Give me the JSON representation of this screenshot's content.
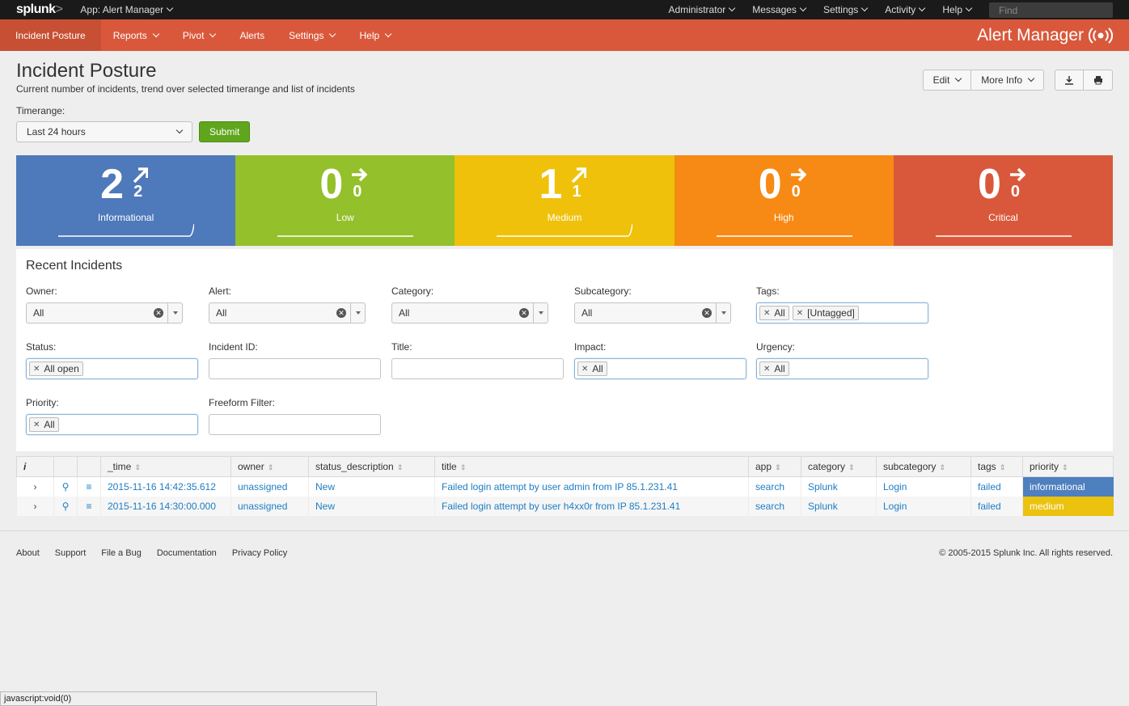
{
  "topbar": {
    "logo_text": "splunk",
    "logo_suffix": ">",
    "app_label": "App: Alert Manager",
    "menus": [
      "Administrator",
      "Messages",
      "Settings",
      "Activity",
      "Help"
    ],
    "find_placeholder": "Find"
  },
  "nav": {
    "items": [
      "Incident Posture",
      "Reports",
      "Pivot",
      "Alerts",
      "Settings",
      "Help"
    ],
    "brand": "Alert Manager"
  },
  "header": {
    "title": "Incident Posture",
    "description": "Current number of incidents, trend over selected timerange and list of incidents",
    "edit_label": "Edit",
    "more_info_label": "More Info"
  },
  "timerange": {
    "label": "Timerange:",
    "value": "Last 24 hours",
    "submit_label": "Submit"
  },
  "tiles": [
    {
      "value": "2",
      "delta": "2",
      "label": "Informational",
      "color": "#4e79ba",
      "trend": "up"
    },
    {
      "value": "0",
      "delta": "0",
      "label": "Low",
      "color": "#93c02b",
      "trend": "flat"
    },
    {
      "value": "1",
      "delta": "1",
      "label": "Medium",
      "color": "#efc10b",
      "trend": "up"
    },
    {
      "value": "0",
      "delta": "0",
      "label": "High",
      "color": "#f68a15",
      "trend": "flat"
    },
    {
      "value": "0",
      "delta": "0",
      "label": "Critical",
      "color": "#d9583b",
      "trend": "flat"
    }
  ],
  "filters": {
    "title": "Recent Incidents",
    "owner": {
      "label": "Owner:",
      "value": "All"
    },
    "alert": {
      "label": "Alert:",
      "value": "All"
    },
    "category": {
      "label": "Category:",
      "value": "All"
    },
    "subcategory": {
      "label": "Subcategory:",
      "value": "All"
    },
    "tags": {
      "label": "Tags:",
      "chips": [
        "All",
        "[Untagged]"
      ]
    },
    "status": {
      "label": "Status:",
      "chips": [
        "All open"
      ]
    },
    "incident_id": {
      "label": "Incident ID:"
    },
    "title_field": {
      "label": "Title:"
    },
    "impact": {
      "label": "Impact:",
      "chips": [
        "All"
      ]
    },
    "urgency": {
      "label": "Urgency:",
      "chips": [
        "All"
      ]
    },
    "priority": {
      "label": "Priority:",
      "chips": [
        "All"
      ]
    },
    "freeform": {
      "label": "Freeform Filter:"
    }
  },
  "table": {
    "columns": [
      "i",
      "_time",
      "owner",
      "status_description",
      "title",
      "app",
      "category",
      "subcategory",
      "tags",
      "priority"
    ],
    "rows": [
      {
        "time": "2015-11-16 14:42:35.612",
        "owner": "unassigned",
        "status": "New",
        "title": "Failed login attempt by user admin from IP 85.1.231.41",
        "app": "search",
        "category": "Splunk",
        "subcategory": "Login",
        "tags": "failed",
        "priority": "informational"
      },
      {
        "time": "2015-11-16 14:30:00.000",
        "owner": "unassigned",
        "status": "New",
        "title": "Failed login attempt by user h4xx0r from IP 85.1.231.41",
        "app": "search",
        "category": "Splunk",
        "subcategory": "Login",
        "tags": "failed",
        "priority": "medium"
      }
    ]
  },
  "footer": {
    "links": [
      "About",
      "Support",
      "File a Bug",
      "Documentation",
      "Privacy Policy"
    ],
    "copyright": "© 2005-2015 Splunk Inc. All rights reserved."
  },
  "statusbar": "javascript:void(0)"
}
